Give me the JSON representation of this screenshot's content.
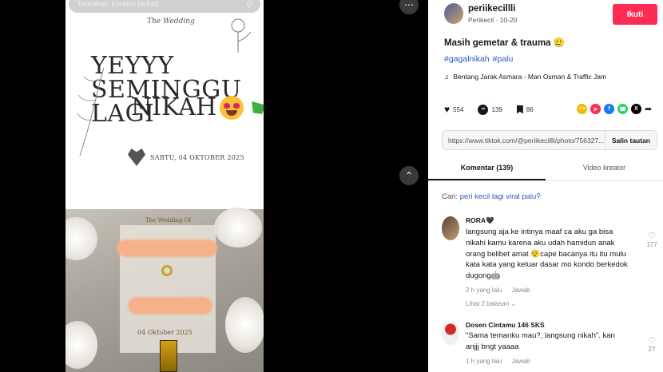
{
  "viewer": {
    "search_placeholder": "Temukan konten terkait",
    "wedding_script": "The Wedding",
    "banner_line1": "YEYYY SEMINGGU LAGI",
    "banner_line2": "NIKAH",
    "card_date": "SABTU, 04 OKTOBER 2025",
    "plaque_title": "The Wedding Of",
    "plaque_date": "04 Oktober 2025",
    "more_icon": "ellipsis-icon",
    "scroll_up_icon": "chevron-up-icon"
  },
  "panel": {
    "author": {
      "username": "periikecillli",
      "meta": "Perikecil · 10-20"
    },
    "follow_label": "Ikuti",
    "caption": "Masih gemetar & trauma 🥲",
    "hashtags": [
      "#gagalnikah",
      "#palu"
    ],
    "music": "Bentang Jarak Asmara - Man Osman & Traffic Jam",
    "stats": {
      "likes": "554",
      "comments": "139",
      "saves": "86"
    },
    "link": "https://www.tiktok.com/@periikecillli/photo/756327...",
    "copy_label": "Salin tautan",
    "tabs": [
      "Komentar (139)",
      "Video kreator"
    ],
    "search_prefix": "Cari:",
    "search_query": "peri kecil lagi viral palu",
    "comments": [
      {
        "user": "RORA🖤",
        "text": "langsung aja ke intinya maaf ca aku ga bisa nikahi kamu karena aku udah hamidun anak orang belibet amat 😮‍💨cape bacanya itu itu mulu kata kata yang keluar dasar mo kondo berkedok dugong🤖",
        "time": "2 h yang lalu",
        "reply": "Jawab",
        "likes": "177",
        "replies": "Lihat 2 balasan ⌄"
      },
      {
        "user": "Dosen Cintamu 146 SKS",
        "text": "\"Sama temanku mau?, langsung nikah\". kan anjjj bngt yaaaa",
        "time": "1 h yang lalu",
        "reply": "Jawab",
        "likes": "27"
      }
    ]
  },
  "colors": {
    "follow": "#fe2c55",
    "link": "#2b5db9",
    "text": "#161823"
  }
}
